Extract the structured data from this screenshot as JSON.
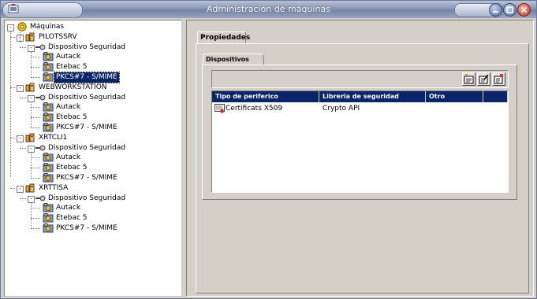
{
  "window": {
    "title": "Administración de máquinas"
  },
  "tree": {
    "root": "Máquinas",
    "machines": [
      {
        "name": "PILOTSSRV",
        "device_group": "Dispositivo Seguridad",
        "children": [
          "Autack",
          "Etebac 5",
          "PKCS#7 - S/MIME"
        ]
      },
      {
        "name": "WEBWORKSTATION",
        "device_group": "Dispositivo Seguridad",
        "children": [
          "Autack",
          "Etebac 5",
          "PKCS#7 - S/MIME"
        ]
      },
      {
        "name": "XRTCLI1",
        "device_group": "Dispositivo Seguridad",
        "children": [
          "Autack",
          "Etebac 5",
          "PKCS#7 - S/MIME"
        ]
      },
      {
        "name": "XRTTISA",
        "device_group": "Dispositivo Seguridad",
        "children": [
          "Autack",
          "Etebac 5",
          "PKCS#7 - S/MIME"
        ]
      }
    ],
    "selected": "PILOTSSRV / PKCS#7 - S/MIME"
  },
  "tabs": {
    "main": "Propiedades",
    "sub": "Dispositivos"
  },
  "toolbar": {
    "icons": [
      "add-device-icon",
      "edit-device-icon",
      "delete-device-icon"
    ]
  },
  "table": {
    "columns": [
      "Tipo de periferico",
      "Libreria de seguridad",
      "Otro",
      ""
    ],
    "rows": [
      {
        "type": "Certificats X509",
        "library": "Crypto API",
        "other": ""
      }
    ]
  },
  "colors": {
    "selection": "#0a246a",
    "header": "#0a246a",
    "face": "#d4d0c8"
  }
}
